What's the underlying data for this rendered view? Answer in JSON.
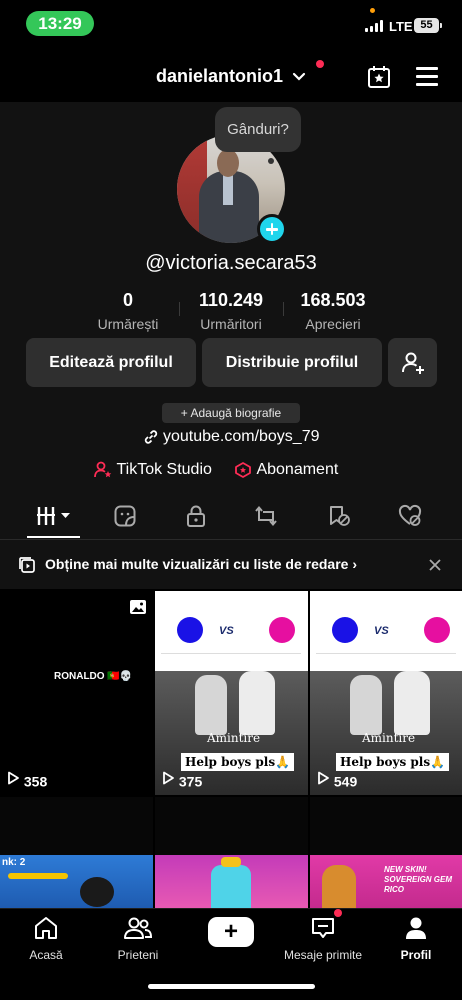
{
  "status_bar": {
    "time": "13:29",
    "network": "LTE",
    "battery": "55"
  },
  "header": {
    "username": "danielantonio1"
  },
  "profile": {
    "thought_bubble": "Gânduri?",
    "handle": "@victoria.secara53",
    "stats": [
      {
        "value": "0",
        "label": "Urmărești"
      },
      {
        "value": "110.249",
        "label": "Urmăritori"
      },
      {
        "value": "168.503",
        "label": "Aprecieri"
      }
    ],
    "edit_button": "Editează profilul",
    "share_button": "Distribuie profilul",
    "add_bio": "+ Adaugă biografie",
    "link": "youtube.com/boys_79",
    "studio_label": "TikTok Studio",
    "subscription_label": "Abonament"
  },
  "tabs": [
    "videos-grid-icon",
    "private-icon",
    "lock-icon",
    "repost-icon",
    "saved-icon",
    "liked-icon"
  ],
  "banner": {
    "text": "Obține mai multe vizualizări cu liste de redare ›"
  },
  "videos": [
    {
      "views": "358",
      "caption": "RONALDO 🇵🇹💀"
    },
    {
      "views": "375",
      "caption_top": "Amintire",
      "caption_bottom": "Help boys pls🙏"
    },
    {
      "views": "549",
      "caption_top": "Amintire",
      "caption_bottom": "Help boys pls🙏"
    }
  ],
  "bottom_row": {
    "text_left": "nk: 2",
    "promo": "NEW SKIN! SOVEREIGN GEM RICO"
  },
  "nav": [
    {
      "label": "Acasă"
    },
    {
      "label": "Prieteni"
    },
    {
      "label": ""
    },
    {
      "label": "Mesaje primite"
    },
    {
      "label": "Profil"
    }
  ],
  "colors": {
    "accent": "#fe2c55",
    "cyan": "#20d5ec",
    "status_green": "#34c759"
  }
}
